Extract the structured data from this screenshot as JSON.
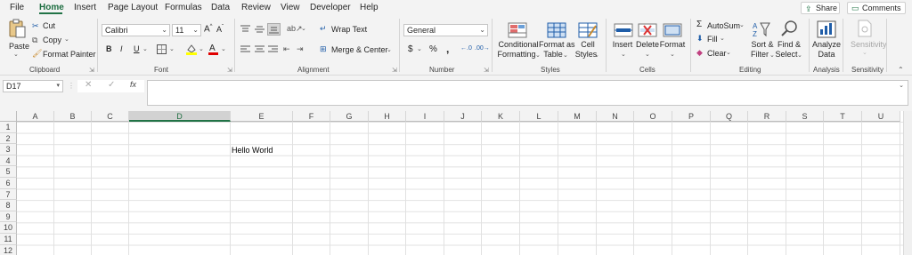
{
  "menu": {
    "items": [
      "File",
      "Home",
      "Insert",
      "Page Layout",
      "Formulas",
      "Data",
      "Review",
      "View",
      "Developer",
      "Help"
    ],
    "share": "Share",
    "comments": "Comments"
  },
  "clipboard": {
    "paste": "Paste",
    "cut": "Cut",
    "copy": "Copy",
    "format_painter": "Format Painter",
    "label": "Clipboard"
  },
  "font": {
    "name": "Calibri",
    "size": "11",
    "bold": "B",
    "italic": "I",
    "underline": "U",
    "label": "Font"
  },
  "alignment": {
    "wrap_text": "Wrap Text",
    "merge_center": "Merge & Center",
    "label": "Alignment"
  },
  "number": {
    "format": "General",
    "currency": "$",
    "percent": "%",
    "comma": ",",
    "label": "Number"
  },
  "styles": {
    "conditional": [
      "Conditional",
      "Formatting"
    ],
    "format_table": [
      "Format as",
      "Table"
    ],
    "cell_styles": [
      "Cell",
      "Styles"
    ],
    "label": "Styles"
  },
  "cells": {
    "insert": "Insert",
    "delete": "Delete",
    "format": "Format",
    "label": "Cells"
  },
  "editing": {
    "autosum": "AutoSum",
    "fill": "Fill",
    "clear": "Clear",
    "sort": [
      "Sort &",
      "Filter"
    ],
    "find": [
      "Find &",
      "Select"
    ],
    "label": "Editing"
  },
  "analysis": {
    "analyze": [
      "Analyze",
      "Data"
    ],
    "label": "Analysis"
  },
  "sensitivity": {
    "button": "Sensitivity",
    "label": "Sensitivity"
  },
  "formula_bar": {
    "name_box": "D17",
    "formula": ""
  },
  "sheet": {
    "columns": [
      "A",
      "B",
      "C",
      "D",
      "E",
      "F",
      "G",
      "H",
      "I",
      "J",
      "K",
      "L",
      "M",
      "N",
      "O",
      "P",
      "Q",
      "R",
      "S",
      "T",
      "U"
    ],
    "rows": [
      "1",
      "2",
      "3",
      "4",
      "5",
      "6",
      "7",
      "8",
      "9",
      "10",
      "11",
      "12"
    ],
    "selected_column": "D",
    "cell_E3": "Hello World"
  },
  "colors": {
    "accent": "#217346",
    "ribbon_bg": "#f3f3f3"
  }
}
